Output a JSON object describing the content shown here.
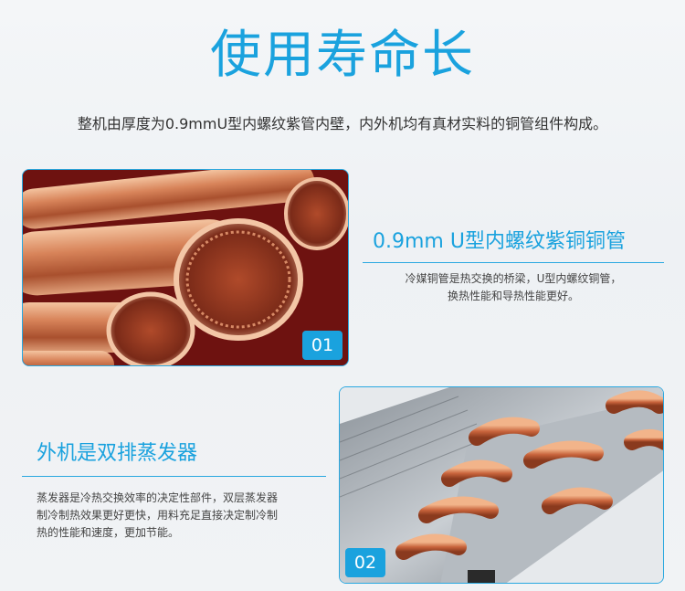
{
  "header": {
    "title": "使用寿命长",
    "lead": "整机由厚度为0.9mmU型内螺纹紫管内壁，内外机均有真材实料的铜管组件构成。"
  },
  "features": [
    {
      "badge": "01",
      "title": "0.9mm U型内螺纹紫铜铜管",
      "desc_lines": [
        "冷媒铜管是热交换的桥梁，U型内螺纹铜管，",
        "换热性能和导热性能更好。"
      ]
    },
    {
      "badge": "02",
      "title": "外机是双排蒸发器",
      "desc_lines": [
        "蒸发器是冷热交换效率的决定性部件，双层蒸发器",
        "制冷制热效果更好更快，用料充足直接决定制冷制",
        "热的性能和速度，更加节能。"
      ]
    }
  ],
  "colors": {
    "accent": "#1aa2de",
    "text": "#333333",
    "copper": "#c8643c"
  }
}
